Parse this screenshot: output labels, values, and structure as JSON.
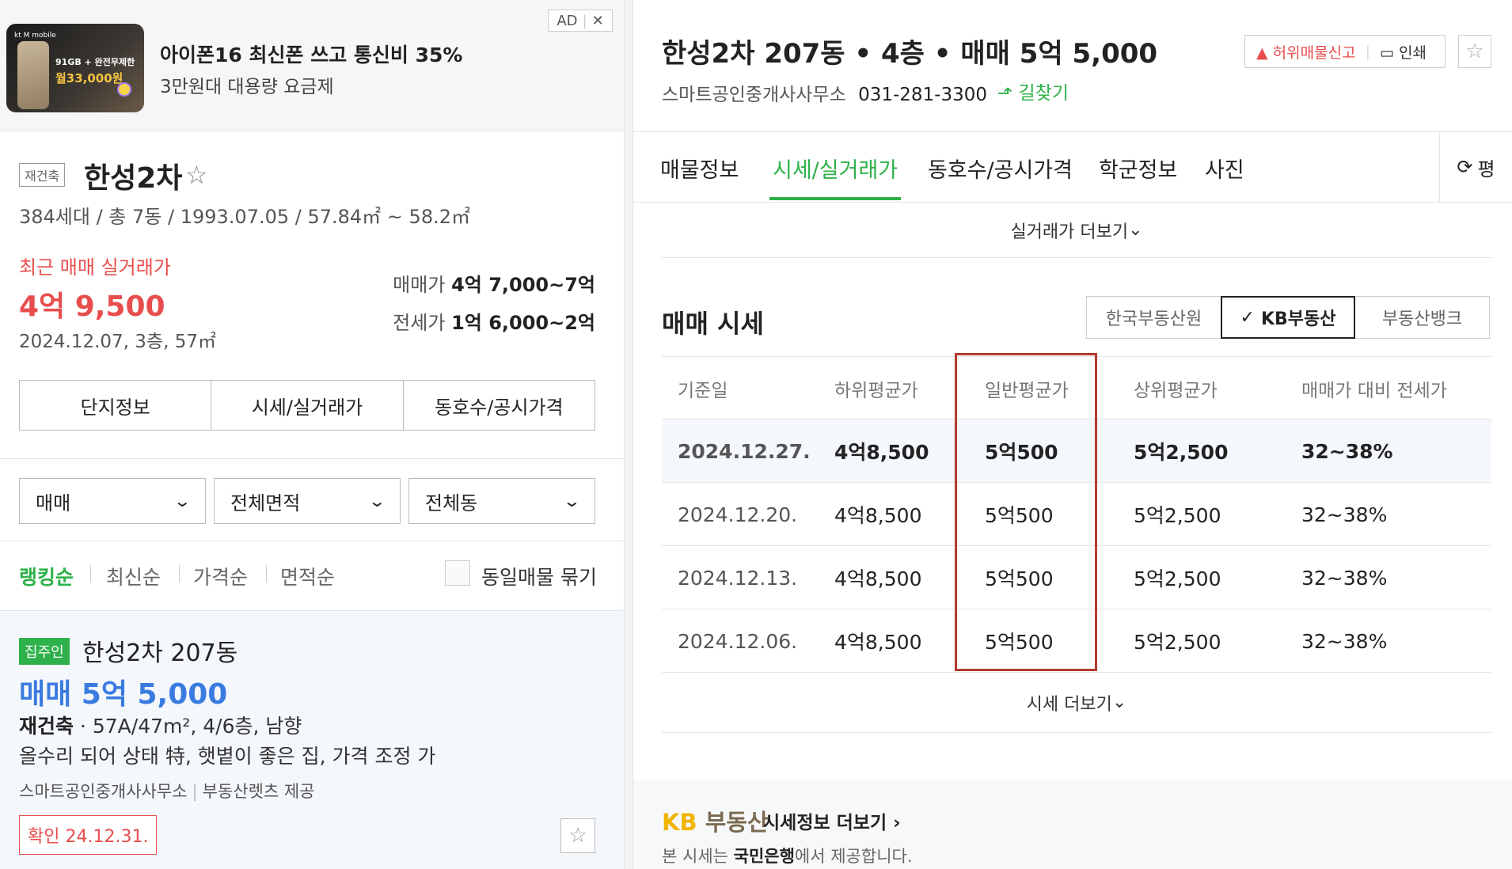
{
  "ad": {
    "tag": "AD",
    "close": "✕",
    "thumb_brand": "kt M mobile",
    "thumb_line1": "91GB + 완전무제한",
    "thumb_line2": "월33,000원",
    "title": "아이폰16 최신폰 쓰고 통신비 35%",
    "subtitle": "3만원대 대용량 요금제"
  },
  "complex": {
    "tag": "재건축",
    "name": "한성2차",
    "star": "☆",
    "info": "384세대 / 총 7동 / 1993.07.05 / 57.84㎡ ~ 58.2㎡",
    "recent_label": "최근 매매 실거래가",
    "recent_price": "4억 9,500",
    "recent_meta": "2024.12.07, 3층, 57㎡",
    "sale_label": "매매가",
    "sale_range": "4억 7,000~7억",
    "jeonse_label": "전세가",
    "jeonse_range": "1억 6,000~2억",
    "buttons": [
      "단지정보",
      "시세/실거래가",
      "동호수/공시가격"
    ]
  },
  "filters": {
    "type": "매매",
    "area": "전체면적",
    "dong": "전체동"
  },
  "sort": {
    "items": [
      "랭킹순",
      "최신순",
      "가격순",
      "면적순"
    ],
    "group_label": "동일매물 묶기"
  },
  "listing": {
    "owner_tag": "집주인",
    "title": "한성2차 207동",
    "price": "매매 5억 5,000",
    "spec_bold": "재건축",
    "spec": " · 57A/47m², 4/6층, 남향",
    "desc": "올수리 되어 상태 特, 햇볕이 좋은 집, 가격 조정 가",
    "agent": "스마트공인중개사사무소",
    "provider": "부동산렛츠 제공",
    "confirm": "확인 24.12.31."
  },
  "detail": {
    "title": "한성2차 207동 • 4층 • 매매 5억 5,000",
    "agent": "스마트공인중개사사무소",
    "phone": "031-281-3300",
    "route": "길찾기",
    "report": "허위매물신고",
    "print": "인쇄",
    "tabs": [
      "매물정보",
      "시세/실거래가",
      "동호수/공시가격",
      "학군정보",
      "사진"
    ],
    "refresh_label": "평",
    "more_trans": "실거래가 더보기",
    "section_title": "매매 시세",
    "sources": [
      "한국부동산원",
      "KB부동산",
      "부동산뱅크"
    ],
    "table_headers": [
      "기준일",
      "하위평균가",
      "일반평균가",
      "상위평균가",
      "매매가 대비 전세가"
    ],
    "table_rows": [
      [
        "2024.12.27.",
        "4억8,500",
        "5억500",
        "5억2,500",
        "32~38%"
      ],
      [
        "2024.12.20.",
        "4억8,500",
        "5억500",
        "5억2,500",
        "32~38%"
      ],
      [
        "2024.12.13.",
        "4억8,500",
        "5억500",
        "5억2,500",
        "32~38%"
      ],
      [
        "2024.12.06.",
        "4억8,500",
        "5억500",
        "5억2,500",
        "32~38%"
      ]
    ],
    "more_price": "시세 더보기",
    "kb_logo_kb": "KB",
    "kb_logo_re": "부동산",
    "kb_link": "시세정보 더보기",
    "kb_note_pre": "본 시세는 ",
    "kb_note_bank": "국민은행",
    "kb_note_post": "에서 제공합니다."
  },
  "colors": {
    "accent_green": "#2eb14a",
    "price_red": "#e84d4d",
    "price_blue": "#3a7be0",
    "highlight_box": "#b53a2e",
    "kb_yellow": "#f0b400"
  }
}
